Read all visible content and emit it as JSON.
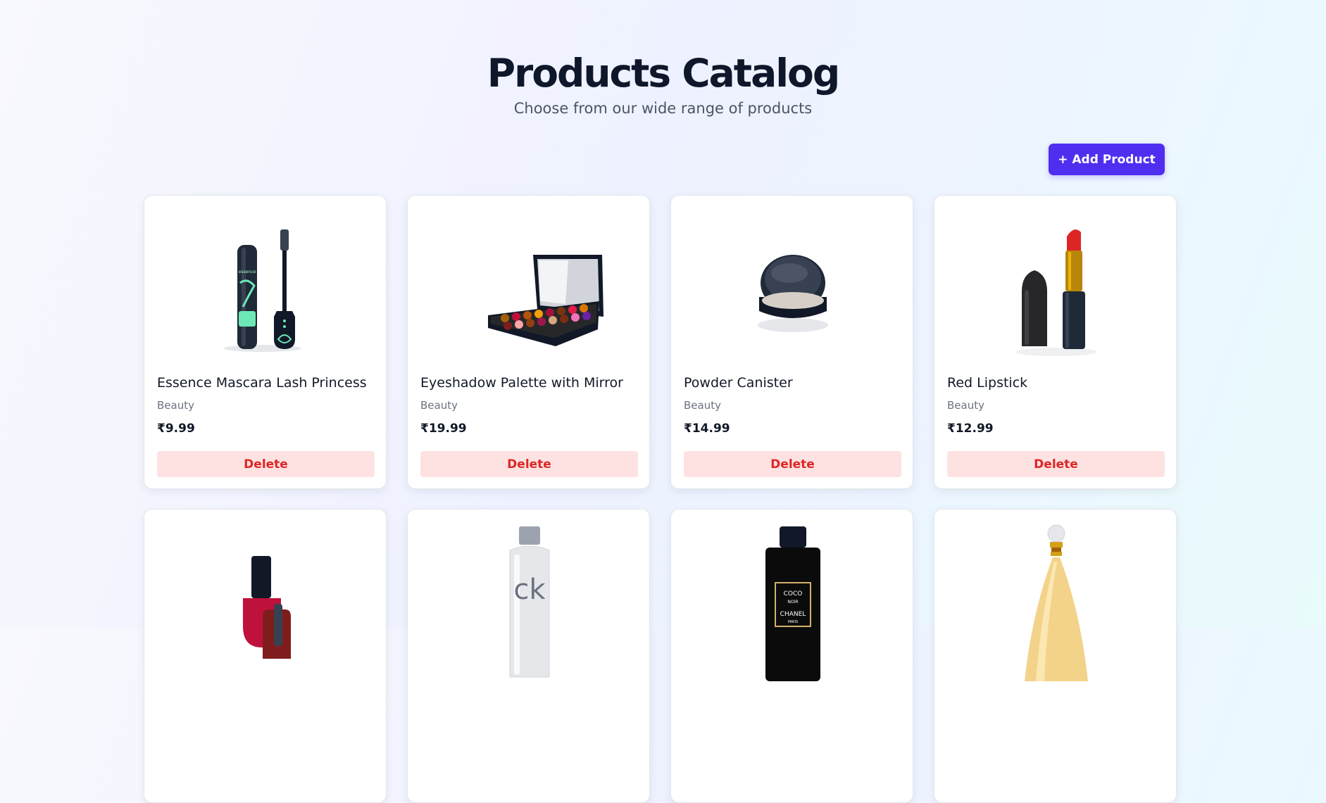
{
  "header": {
    "title": "Products Catalog",
    "subtitle": "Choose from our wide range of products"
  },
  "toolbar": {
    "add_label": "+ Add Product"
  },
  "accent_color": "#4f2ef0",
  "currency": "₹",
  "products": [
    {
      "name": "Essence Mascara Lash Princess",
      "category": "Beauty",
      "price": "₹9.99",
      "delete_label": "Delete",
      "icon": "mascara-image",
      "image_text": "essence"
    },
    {
      "name": "Eyeshadow Palette with Mirror",
      "category": "Beauty",
      "price": "₹19.99",
      "delete_label": "Delete",
      "icon": "eyeshadow-palette-image"
    },
    {
      "name": "Powder Canister",
      "category": "Beauty",
      "price": "₹14.99",
      "delete_label": "Delete",
      "icon": "powder-canister-image"
    },
    {
      "name": "Red Lipstick",
      "category": "Beauty",
      "price": "₹12.99",
      "delete_label": "Delete",
      "icon": "lipstick-image"
    },
    {
      "icon": "nail-polish-image"
    },
    {
      "icon": "perfume-bottle-image",
      "image_text": "ck"
    },
    {
      "icon": "chanel-bottle-image",
      "image_text": [
        "COCO",
        "NOIR",
        "CHANEL",
        "PARIS"
      ]
    },
    {
      "icon": "dior-bottle-image"
    }
  ]
}
